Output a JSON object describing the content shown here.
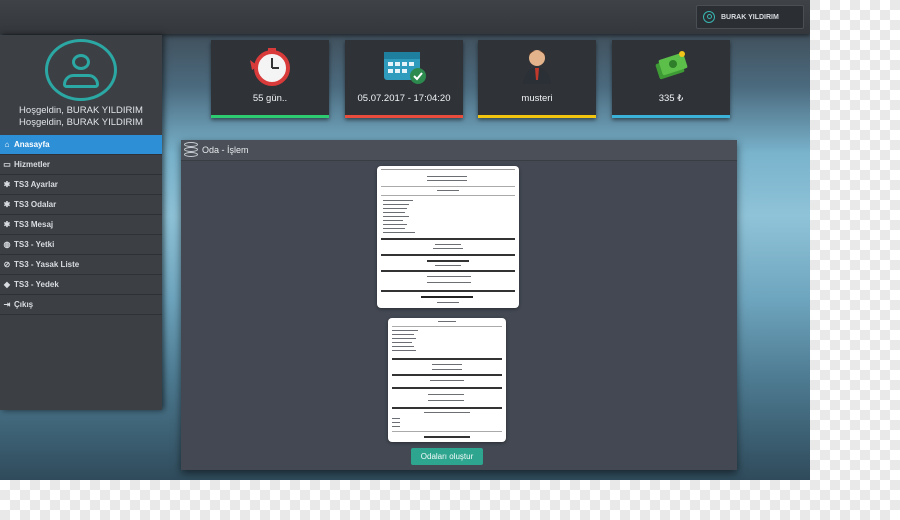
{
  "header": {
    "user_name": "BURAK YILDIRIM"
  },
  "sidebar": {
    "welcome_line1": "Hoşgeldin, BURAK YILDIRIM",
    "welcome_line2": "Hoşgeldin, BURAK YILDIRIM",
    "items": [
      {
        "label": "Anasayfa",
        "icon": "home-icon",
        "active": true
      },
      {
        "label": "Hizmetler",
        "icon": "card-icon",
        "active": false
      },
      {
        "label": "TS3 Ayarlar",
        "icon": "gear-icon",
        "active": false
      },
      {
        "label": "TS3 Odalar",
        "icon": "gear-icon",
        "active": false
      },
      {
        "label": "TS3 Mesaj",
        "icon": "gear-icon",
        "active": false
      },
      {
        "label": "TS3 - Yetki",
        "icon": "globe-icon",
        "active": false
      },
      {
        "label": "TS3 - Yasak Liste",
        "icon": "ban-icon",
        "active": false
      },
      {
        "label": "TS3 - Yedek",
        "icon": "tag-icon",
        "active": false
      },
      {
        "label": "Çıkış",
        "icon": "logout-icon",
        "active": false
      }
    ]
  },
  "cards": [
    {
      "value": "55 gün..",
      "icon": "stopwatch-icon",
      "bar_color": "#2ecc71"
    },
    {
      "value": "05.07.2017 - 17:04:20",
      "icon": "calendar-icon",
      "bar_color": "#e74c3c"
    },
    {
      "value": "musteri",
      "icon": "businessman-icon",
      "bar_color": "#f1c40f"
    },
    {
      "value": "335 ₺",
      "icon": "money-icon",
      "bar_color": "#3bb3d9"
    }
  ],
  "panel": {
    "title": "Oda - İşlem",
    "button_label": "Odaları oluştur"
  },
  "colors": {
    "accent": "#2d8fd6",
    "teal": "#2ba8a4",
    "button": "#2ea58f"
  }
}
